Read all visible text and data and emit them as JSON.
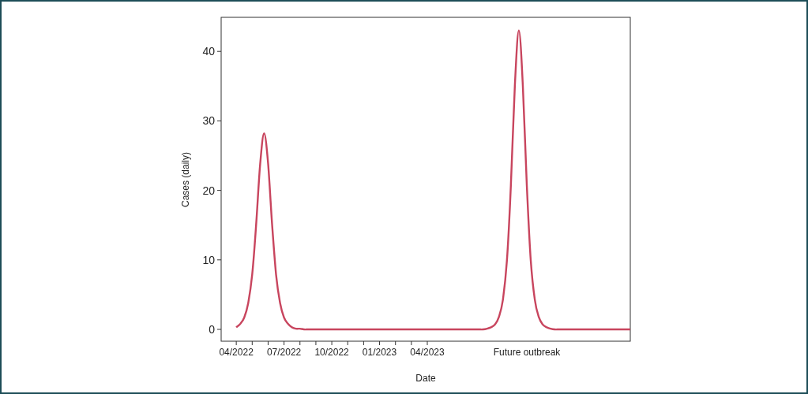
{
  "figure": {
    "chart_data": {
      "type": "line",
      "xlabel": "Date",
      "ylabel": "Cases (daily)",
      "categories": [
        "04/2022",
        null,
        null,
        null,
        null,
        null,
        null,
        null,
        null,
        null,
        null,
        null,
        "07/2022",
        null,
        null,
        null,
        null,
        null,
        null,
        null,
        null,
        null,
        null,
        null,
        "10/2022",
        null,
        null,
        null,
        null,
        null,
        null,
        null,
        null,
        null,
        null,
        null,
        "01/2023",
        null,
        null,
        null,
        null,
        null,
        null,
        null,
        null,
        null,
        null,
        null,
        "04/2023",
        null,
        null,
        null,
        null,
        null,
        null,
        null,
        null,
        null,
        null,
        null,
        null,
        null,
        null,
        null,
        null,
        null,
        null,
        null,
        null,
        null,
        null,
        null,
        null,
        "Future outbreak",
        null,
        null,
        null,
        null,
        null,
        null,
        null,
        null,
        null,
        null,
        null,
        null,
        null,
        null,
        null,
        null,
        null,
        null,
        null,
        null,
        null,
        null,
        null,
        null,
        null,
        null
      ],
      "series": [
        {
          "color": "#c8455e",
          "values": [
            0.3,
            0.8,
            1.7,
            3.8,
            7.9,
            15.1,
            23.8,
            28.2,
            23.8,
            15.1,
            7.9,
            3.8,
            1.7,
            0.8,
            0.3,
            0.1,
            0.1,
            0,
            0,
            0,
            0,
            0,
            0,
            0,
            0,
            0,
            0,
            0,
            0,
            0,
            0,
            0,
            0,
            0,
            0,
            0,
            0,
            0,
            0,
            0,
            0,
            0,
            0,
            0,
            0,
            0,
            0,
            0,
            0,
            0,
            0,
            0,
            0,
            0,
            0,
            0,
            0,
            0,
            0,
            0,
            0,
            0,
            0,
            0.1,
            0.3,
            0.7,
            1.8,
            4.3,
            9.9,
            20.7,
            35.2,
            43,
            35.2,
            20.7,
            9.9,
            4.3,
            1.8,
            0.7,
            0.3,
            0.1,
            0,
            0,
            0,
            0,
            0,
            0,
            0,
            0,
            0,
            0,
            0,
            0,
            0,
            0,
            0,
            0,
            0,
            0,
            0,
            0
          ]
        }
      ],
      "ylim": [
        -1.7,
        44.9
      ],
      "yticks": [
        0,
        10,
        20,
        30,
        40
      ]
    }
  }
}
